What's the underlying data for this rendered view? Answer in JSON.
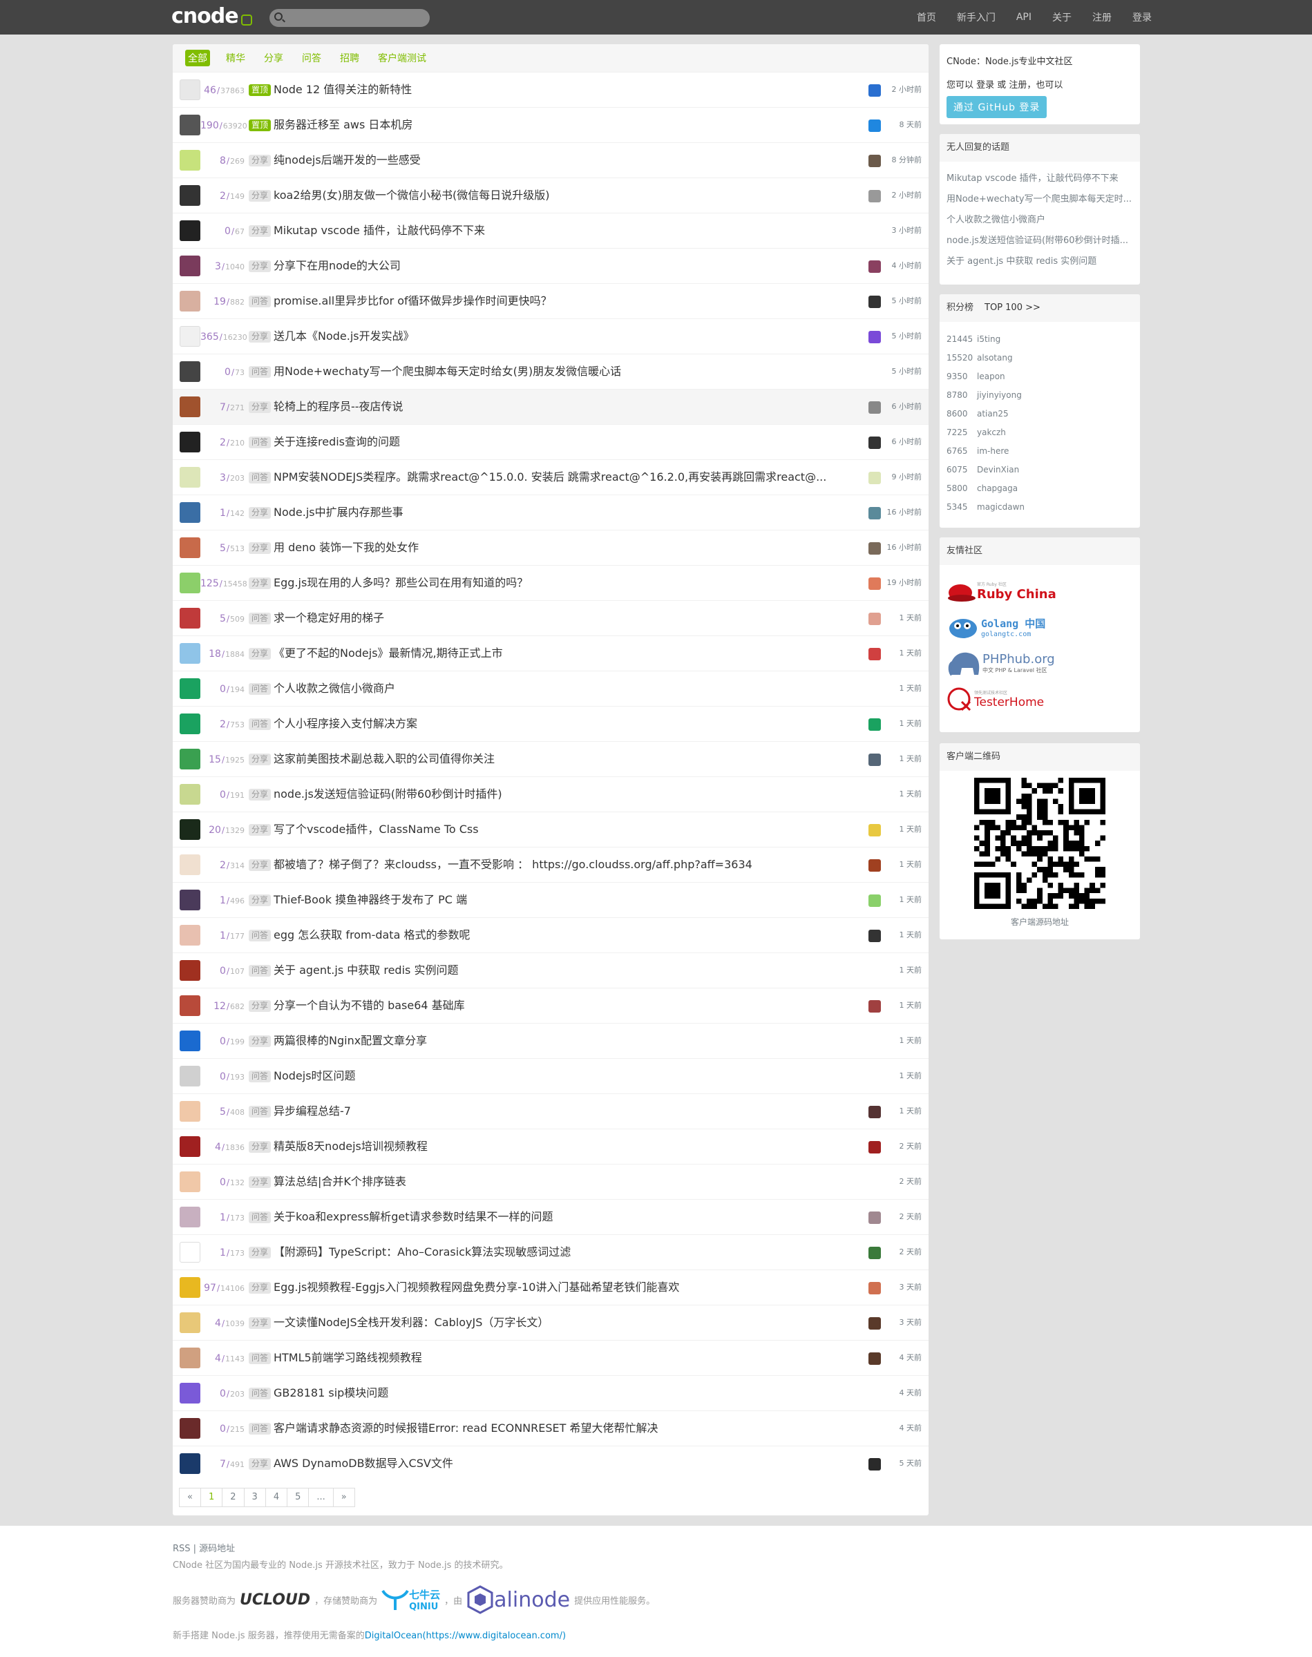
{
  "logo": "cnode",
  "nav": [
    "首页",
    "新手入门",
    "API",
    "关于",
    "注册",
    "登录"
  ],
  "tabs": [
    "全部",
    "精华",
    "分享",
    "问答",
    "招聘",
    "客户端测试"
  ],
  "topics": [
    {
      "replies": "46",
      "visits": "37863",
      "tag": "置顶",
      "title": "Node 12 值得关注的新特性",
      "time": "2 小时前",
      "av": "#e8e8e8",
      "ra": "#2a6fd0"
    },
    {
      "replies": "190",
      "visits": "63920",
      "tag": "置顶",
      "title": "服务器迁移至 aws 日本机房",
      "time": "8 天前",
      "av": "#555555",
      "ra": "#1f87e0"
    },
    {
      "replies": "8",
      "visits": "269",
      "tag": "分享",
      "title": "纯nodejs后端开发的一些感受",
      "time": "8 分钟前",
      "av": "#c7e27c",
      "ra": "#6b5a4a"
    },
    {
      "replies": "2",
      "visits": "149",
      "tag": "分享",
      "title": "koa2给男(女)朋友做一个微信小秘书(微信每日说升级版)",
      "time": "2 小时前",
      "av": "#333333",
      "ra": "#999999"
    },
    {
      "replies": "0",
      "visits": "67",
      "tag": "分享",
      "title": "Mikutap vscode 插件，让敲代码停不下来",
      "time": "3 小时前",
      "av": "#222222",
      "ra": ""
    },
    {
      "replies": "3",
      "visits": "1040",
      "tag": "分享",
      "title": "分享下在用node的大公司",
      "time": "4 小时前",
      "av": "#7a3b5c",
      "ra": "#8a4060"
    },
    {
      "replies": "19",
      "visits": "882",
      "tag": "问答",
      "title": "promise.all里异步比for of循环做异步操作时间更快吗？",
      "time": "5 小时前",
      "av": "#d8b0a0",
      "ra": "#333333"
    },
    {
      "replies": "365",
      "visits": "16230",
      "tag": "分享",
      "title": "送几本《Node.js开发实战》",
      "time": "5 小时前",
      "av": "#f0f0f0",
      "ra": "#7a4ad8"
    },
    {
      "replies": "0",
      "visits": "73",
      "tag": "问答",
      "title": "用Node+wechaty写一个爬虫脚本每天定时给女(男)朋友发微信暖心话",
      "time": "5 小时前",
      "av": "#444444",
      "ra": ""
    },
    {
      "replies": "7",
      "visits": "271",
      "tag": "分享",
      "title": "轮椅上的程序员--夜店传说",
      "time": "6 小时前",
      "av": "#a0522d",
      "ra": "#888888",
      "hl": true
    },
    {
      "replies": "2",
      "visits": "210",
      "tag": "问答",
      "title": "关于连接redis查询的问题",
      "time": "6 小时前",
      "av": "#222222",
      "ra": "#333333"
    },
    {
      "replies": "3",
      "visits": "203",
      "tag": "问答",
      "title": "NPM安装NODEJS类程序。跳需求react@^15.0.0. 安装后 跳需求react@^16.2.0,再安装再跳回需求react@...",
      "time": "9 小时前",
      "av": "#dde6b8",
      "ra": "#dde6b8"
    },
    {
      "replies": "1",
      "visits": "142",
      "tag": "分享",
      "title": "Node.js中扩展内存那些事",
      "time": "16 小时前",
      "av": "#3a6ea5",
      "ra": "#5a8a9a"
    },
    {
      "replies": "5",
      "visits": "513",
      "tag": "分享",
      "title": "用 deno 装饰一下我的处女作",
      "time": "16 小时前",
      "av": "#c86a4a",
      "ra": "#7a6a5a"
    },
    {
      "replies": "125",
      "visits": "15458",
      "tag": "分享",
      "title": "Egg.js现在用的人多吗？那些公司在用有知道的吗？",
      "time": "19 小时前",
      "av": "#8ccf6a",
      "ra": "#e07a5a"
    },
    {
      "replies": "5",
      "visits": "509",
      "tag": "问答",
      "title": "求一个稳定好用的梯子",
      "time": "1 天前",
      "av": "#c03a3a",
      "ra": "#e0a090"
    },
    {
      "replies": "18",
      "visits": "1884",
      "tag": "分享",
      "title": "《更了不起的Nodejs》最新情况,期待正式上市",
      "time": "1 天前",
      "av": "#8fc4e8",
      "ra": "#d04040"
    },
    {
      "replies": "0",
      "visits": "194",
      "tag": "问答",
      "title": "个人收款之微信小微商户",
      "time": "1 天前",
      "av": "#1aa260",
      "ra": ""
    },
    {
      "replies": "2",
      "visits": "753",
      "tag": "问答",
      "title": "个人小程序接入支付解决方案",
      "time": "1 天前",
      "av": "#1aa260",
      "ra": "#1aa260"
    },
    {
      "replies": "15",
      "visits": "1925",
      "tag": "分享",
      "title": "这家前美图技术副总裁入职的公司值得你关注",
      "time": "1 天前",
      "av": "#3aa050",
      "ra": "#556677"
    },
    {
      "replies": "0",
      "visits": "191",
      "tag": "分享",
      "title": "node.js发送短信验证码(附带60秒倒计时插件)",
      "time": "1 天前",
      "av": "#c8d890",
      "ra": ""
    },
    {
      "replies": "20",
      "visits": "1329",
      "tag": "分享",
      "title": "写了个vscode插件，ClassName To Css",
      "time": "1 天前",
      "av": "#1a2a1a",
      "ra": "#e8c840"
    },
    {
      "replies": "2",
      "visits": "314",
      "tag": "分享",
      "title": "都被墙了？梯子倒了？来cloudss，一直不受影响 ： https://go.cloudss.org/aff.php?aff=3634",
      "time": "1 天前",
      "av": "#f0e0d0",
      "ra": "#a04020"
    },
    {
      "replies": "1",
      "visits": "496",
      "tag": "分享",
      "title": "Thief-Book 摸鱼神器终于发布了 PC 端",
      "time": "1 天前",
      "av": "#4a3a5a",
      "ra": "#8ad06a"
    },
    {
      "replies": "1",
      "visits": "177",
      "tag": "问答",
      "title": "egg 怎么获取 from-data 格式的参数呢",
      "time": "1 天前",
      "av": "#e8c0b0",
      "ra": "#333333"
    },
    {
      "replies": "0",
      "visits": "107",
      "tag": "问答",
      "title": "关于 agent.js 中获取 redis 实例问题",
      "time": "1 天前",
      "av": "#a03020",
      "ra": ""
    },
    {
      "replies": "12",
      "visits": "682",
      "tag": "分享",
      "title": "分享一个自认为不错的 base64 基础库",
      "time": "1 天前",
      "av": "#b84a3a",
      "ra": "#a04040"
    },
    {
      "replies": "0",
      "visits": "199",
      "tag": "分享",
      "title": "两篇很棒的Nginx配置文章分享",
      "time": "1 天前",
      "av": "#1a6ad0",
      "ra": ""
    },
    {
      "replies": "0",
      "visits": "193",
      "tag": "问答",
      "title": "Nodejs时区问题",
      "time": "1 天前",
      "av": "#d0d0d0",
      "ra": ""
    },
    {
      "replies": "5",
      "visits": "408",
      "tag": "问答",
      "title": "异步编程总结-7",
      "time": "1 天前",
      "av": "#f0c8a8",
      "ra": "#553333"
    },
    {
      "replies": "4",
      "visits": "1836",
      "tag": "分享",
      "title": "精英版8天nodejs培训视频教程",
      "time": "2 天前",
      "av": "#a02020",
      "ra": "#a02020"
    },
    {
      "replies": "0",
      "visits": "132",
      "tag": "分享",
      "title": "算法总结|合并K个排序链表",
      "time": "2 天前",
      "av": "#f0c8a8",
      "ra": ""
    },
    {
      "replies": "1",
      "visits": "173",
      "tag": "问答",
      "title": "关于koa和express解析get请求参数时结果不一样的问题",
      "time": "2 天前",
      "av": "#c8b0c0",
      "ra": "#a08890"
    },
    {
      "replies": "1",
      "visits": "173",
      "tag": "分享",
      "title": "【附源码】TypeScript：Aho–Corasick算法实现敏感词过滤",
      "time": "2 天前",
      "av": "#ffffff",
      "ra": "#3a7a3a"
    },
    {
      "replies": "97",
      "visits": "14106",
      "tag": "分享",
      "title": "Egg.js视频教程-Eggjs入门视频教程网盘免费分享-10讲入门基础希望老铁们能喜欢",
      "time": "3 天前",
      "av": "#e8b820",
      "ra": "#d07050"
    },
    {
      "replies": "4",
      "visits": "1039",
      "tag": "分享",
      "title": "一文读懂NodeJS全栈开发利器：CabloyJS（万字长文）",
      "time": "3 天前",
      "av": "#e8c878",
      "ra": "#5a3a2a"
    },
    {
      "replies": "4",
      "visits": "1143",
      "tag": "问答",
      "title": "HTML5前端学习路线视频教程",
      "time": "4 天前",
      "av": "#d0a080",
      "ra": "#5a3a2a"
    },
    {
      "replies": "0",
      "visits": "203",
      "tag": "问答",
      "title": "GB28181 sip模块问题",
      "time": "4 天前",
      "av": "#7a5ad8",
      "ra": ""
    },
    {
      "replies": "0",
      "visits": "215",
      "tag": "问答",
      "title": "客户端请求静态资源的时候报错Error: read ECONNRESET 希望大佬帮忙解决",
      "time": "4 天前",
      "av": "#6a2a2a",
      "ra": ""
    },
    {
      "replies": "7",
      "visits": "491",
      "tag": "分享",
      "title": "AWS DynamoDB数据导入CSV文件",
      "time": "5 天前",
      "av": "#1a3a6a",
      "ra": "#2a2a2a"
    }
  ],
  "pager": [
    "«",
    "1",
    "2",
    "3",
    "4",
    "5",
    "...",
    "»"
  ],
  "side": {
    "intro_title": "CNode：Node.js专业中文社区",
    "intro_line": "您可以 登录 或 注册，也可以",
    "github_btn": "通过 GitHub 登录",
    "noreply_title": "无人回复的话题",
    "noreply": [
      "Mikutap vscode 插件，让敲代码停不下来",
      "用Node+wechaty写一个爬虫脚本每天定时...",
      "个人收款之微信小微商户",
      "node.js发送短信验证码(附带60秒倒计时插...",
      "关于 agent.js 中获取 redis 实例问题"
    ],
    "score_title": "积分榜",
    "score_top": "TOP 100 >>",
    "scores": [
      {
        "n": "21445",
        "u": "i5ting"
      },
      {
        "n": "15520",
        "u": "alsotang"
      },
      {
        "n": "9350",
        "u": "leapon"
      },
      {
        "n": "8780",
        "u": "jiyinyiyong"
      },
      {
        "n": "8600",
        "u": "atian25"
      },
      {
        "n": "7225",
        "u": "yakczh"
      },
      {
        "n": "6765",
        "u": "im-here"
      },
      {
        "n": "6075",
        "u": "DevinXian"
      },
      {
        "n": "5800",
        "u": "chapgaga"
      },
      {
        "n": "5345",
        "u": "magicdawn"
      }
    ],
    "friends_title": "友情社区",
    "ruby_small": "官方 Ruby 社区",
    "ruby": "Ruby China",
    "golang": "Golang 中国",
    "golang_sub": "golangtc.com",
    "phphub": "PHPhub.org",
    "phphub_sub": "中文 PHP & Laravel 社区",
    "tester_small": "领先测试技术社区",
    "tester": "TesterHome",
    "qr_title": "客户端二维码",
    "qr_caption": "客户端源码地址"
  },
  "footer": {
    "links": "RSS | 源码地址",
    "desc": "CNode 社区为国内最专业的 Node.js 开源技术社区，致力于 Node.js 的技术研究。",
    "sponsor_a": "服务器赞助商为",
    "ucloud": "UCLOUD",
    "sponsor_b": "，存储赞助商为",
    "qiniu": "七牛云",
    "qiniu_sub": "QINIU",
    "sponsor_c": "，由",
    "alinode": "alinode",
    "sponsor_d": "提供应用性能服务。",
    "rec_a": "新手搭建 Node.js 服务器，推荐使用无需备案的",
    "rec_link": "DigitalOcean(https://www.digitalocean.com/)"
  }
}
